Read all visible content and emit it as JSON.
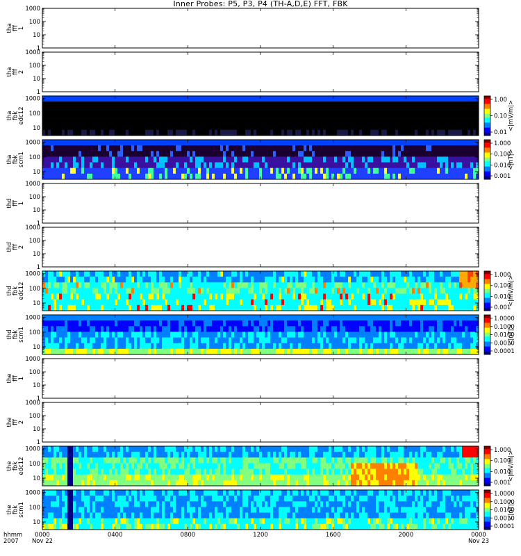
{
  "title": "Inner Probes: P5, P3, P4 (TH-A,D,E) FFT, FBK",
  "chart_data": [
    {
      "type": "heatmap",
      "panel_label": [
        "tha",
        "fff",
        "1"
      ],
      "yticks": [
        "1",
        "10",
        "100",
        "1000"
      ],
      "ylim": [
        1,
        1000
      ],
      "yscale": "log",
      "data": "none"
    },
    {
      "type": "heatmap",
      "panel_label": [
        "tha",
        "fff",
        "2"
      ],
      "yticks": [
        "1",
        "10",
        "100",
        "1000"
      ],
      "ylim": [
        1,
        1000
      ],
      "yscale": "log",
      "data": "none"
    },
    {
      "type": "heatmap",
      "panel_label": [
        "tha",
        "fbk",
        "edc12"
      ],
      "yticks": [
        "10",
        "100",
        "1000"
      ],
      "ylim": [
        3,
        1500
      ],
      "yscale": "log",
      "colorbar": {
        "label": "<|mV/m|>",
        "ticks": [
          "1.00",
          "0.10",
          "0.01"
        ],
        "scale": "log",
        "range": [
          0.005,
          2
        ]
      },
      "pattern": "tha-edc"
    },
    {
      "type": "heatmap",
      "panel_label": [
        "tha",
        "fbk",
        "scm1"
      ],
      "yticks": [
        "10",
        "100",
        "1000"
      ],
      "ylim": [
        3,
        1500
      ],
      "yscale": "log",
      "colorbar": {
        "label": "<|nT|>",
        "ticks": [
          "1.000",
          "0.100",
          "0.010",
          "0.001"
        ],
        "scale": "log",
        "range": [
          0.0005,
          2
        ]
      },
      "pattern": "tha-scm"
    },
    {
      "type": "heatmap",
      "panel_label": [
        "thd",
        "fff",
        "1"
      ],
      "yticks": [
        "1",
        "10",
        "100",
        "1000"
      ],
      "ylim": [
        1,
        1000
      ],
      "yscale": "log",
      "data": "none"
    },
    {
      "type": "heatmap",
      "panel_label": [
        "thd",
        "fff",
        "2"
      ],
      "yticks": [
        "1",
        "10",
        "100",
        "1000"
      ],
      "ylim": [
        1,
        1000
      ],
      "yscale": "log",
      "data": "none"
    },
    {
      "type": "heatmap",
      "panel_label": [
        "thd",
        "fbk",
        "edc12"
      ],
      "yticks": [
        "10",
        "100",
        "1000"
      ],
      "ylim": [
        3,
        1500
      ],
      "yscale": "log",
      "colorbar": {
        "label": "<|mV/m|>",
        "ticks": [
          "1.000",
          "0.100",
          "0.010",
          "0.001"
        ],
        "scale": "log",
        "range": [
          0.0005,
          2
        ]
      },
      "pattern": "thd-edc"
    },
    {
      "type": "heatmap",
      "panel_label": [
        "thd",
        "fbk",
        "scm1"
      ],
      "yticks": [
        "10",
        "100",
        "1000"
      ],
      "ylim": [
        3,
        1500
      ],
      "yscale": "log",
      "colorbar": {
        "label": "<|nT|>",
        "ticks": [
          "1.0000",
          "0.1000",
          "0.0100",
          "0.0010",
          "0.0001"
        ],
        "scale": "log",
        "range": [
          5e-05,
          2
        ]
      },
      "pattern": "thd-scm"
    },
    {
      "type": "heatmap",
      "panel_label": [
        "the",
        "fff",
        "1"
      ],
      "yticks": [
        "1",
        "10",
        "100",
        "1000"
      ],
      "ylim": [
        1,
        1000
      ],
      "yscale": "log",
      "data": "none"
    },
    {
      "type": "heatmap",
      "panel_label": [
        "the",
        "fff",
        "2"
      ],
      "yticks": [
        "1",
        "10",
        "100",
        "1000"
      ],
      "ylim": [
        1,
        1000
      ],
      "yscale": "log",
      "data": "none"
    },
    {
      "type": "heatmap",
      "panel_label": [
        "the",
        "fbk",
        "edc12"
      ],
      "yticks": [
        "10",
        "100",
        "1000"
      ],
      "ylim": [
        3,
        1500
      ],
      "yscale": "log",
      "colorbar": {
        "label": "<|mV/m|>",
        "ticks": [
          "1.000",
          "0.100",
          "0.010",
          "0.001"
        ],
        "scale": "log",
        "range": [
          0.0005,
          2
        ]
      },
      "pattern": "the-edc"
    },
    {
      "type": "heatmap",
      "panel_label": [
        "the",
        "fbk",
        "scm1"
      ],
      "yticks": [
        "10",
        "100",
        "1000"
      ],
      "ylim": [
        3,
        1500
      ],
      "yscale": "log",
      "colorbar": {
        "label": "<|nT|>",
        "ticks": [
          "1.0000",
          "0.1000",
          "0.0100",
          "0.0010",
          "0.0001"
        ],
        "scale": "log",
        "range": [
          5e-05,
          2
        ]
      },
      "pattern": "the-scm"
    }
  ],
  "xaxis": {
    "label_top": "hhmm",
    "label_bottom": "2007",
    "ticks": [
      {
        "t": 0,
        "label": "0000",
        "sub": "Nov 22"
      },
      {
        "t": 240,
        "label": "0400",
        "sub": ""
      },
      {
        "t": 480,
        "label": "0800",
        "sub": ""
      },
      {
        "t": 720,
        "label": "1200",
        "sub": ""
      },
      {
        "t": 960,
        "label": "1600",
        "sub": ""
      },
      {
        "t": 1200,
        "label": "2000",
        "sub": ""
      },
      {
        "t": 1440,
        "label": "0000",
        "sub": "Nov 23"
      }
    ],
    "range_minutes": [
      0,
      1440
    ]
  },
  "colors": {
    "jet": [
      "#000080",
      "#0000ff",
      "#0080ff",
      "#00ffff",
      "#80ff80",
      "#ffff00",
      "#ff8000",
      "#ff0000",
      "#800000"
    ]
  }
}
